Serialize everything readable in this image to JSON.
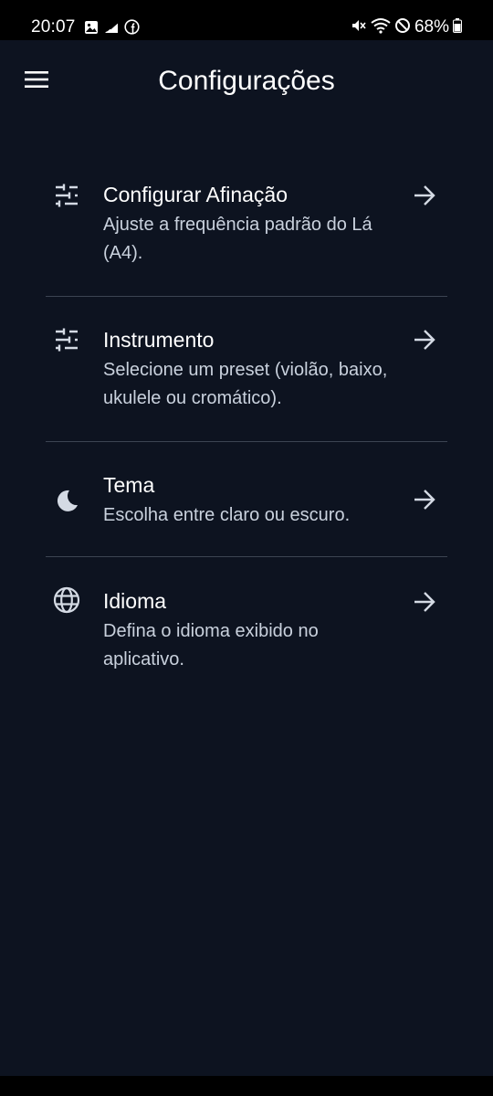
{
  "status_bar": {
    "time": "20:07",
    "battery": "68%",
    "left_icons": [
      "image-icon",
      "signal-strength-icon",
      "facebook-icon"
    ],
    "right_icons": [
      "mute-icon",
      "wifi-icon",
      "do-not-disturb-icon",
      "battery-icon"
    ]
  },
  "app_bar": {
    "title": "Configurações",
    "menu_icon": "hamburger-menu-icon"
  },
  "settings": [
    {
      "icon": "tune-sliders-icon",
      "title": "Configurar Afinação",
      "subtitle": "Ajuste a frequência padrão do Lá (A4)."
    },
    {
      "icon": "tune-sliders-icon",
      "title": "Instrumento",
      "subtitle": "Selecione um preset (violão, baixo, ukulele ou cromático)."
    },
    {
      "icon": "moon-icon",
      "title": "Tema",
      "subtitle": "Escolha entre claro ou escuro."
    },
    {
      "icon": "globe-icon",
      "title": "Idioma",
      "subtitle": "Defina o idioma exibido no aplicativo."
    }
  ],
  "colors": {
    "background": "#0d1320",
    "divider": "#3c4452",
    "text_primary": "#ffffff",
    "text_secondary": "#c9d1dd"
  }
}
